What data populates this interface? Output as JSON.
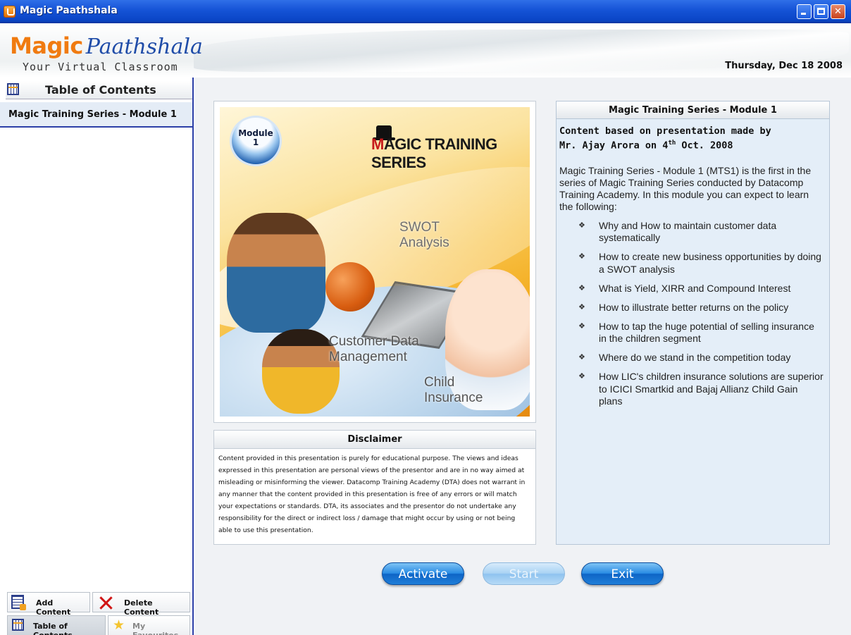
{
  "window": {
    "title": "Magic Paathshala"
  },
  "header": {
    "logo_part1": "Magic",
    "logo_part2": "Paathshala",
    "tagline": "Your Virtual Classroom",
    "date": "Thursday, Dec 18 2008"
  },
  "sidebar": {
    "title": "Table of Contents",
    "items": [
      {
        "label": "Magic Training Series - Module 1"
      }
    ],
    "add_label": "Add Content",
    "delete_label": "Delete Content",
    "toc_tab_label": "Table of Contents",
    "fav_tab_label": "My Favourites"
  },
  "module_image": {
    "badge_line1": "Module",
    "badge_line2": "1",
    "brand_first": "M",
    "brand_rest": "AGIC TRAINING SERIES",
    "label_swot_1": "SWOT",
    "label_swot_2": "Analysis",
    "label_cdm_1": "Customer Data",
    "label_cdm_2": "Management",
    "label_child_1": "Child",
    "label_child_2": "Insurance"
  },
  "disclaimer": {
    "title": "Disclaimer",
    "text": "Content provided in this presentation is purely for educational purpose. The views and ideas expressed in this presentation are personal views of the presentor and are in no way aimed at  misleading or misinforming the viewer. Datacomp Training Academy (DTA) does not warrant in any manner that the content provided in this presentation is free of any errors or will match your expectations or standards. DTA, its associates and the presentor do not undertake any responsibility for the direct or indirect loss / damage that might occur by using or not being able to use this presentation."
  },
  "info": {
    "title": "Magic Training Series - Module 1",
    "subtitle_line1": "Content based on presentation made by",
    "subtitle_line2_a": "Mr. Ajay Arora on 4",
    "subtitle_line2_sup": "th",
    "subtitle_line2_b": " Oct. 2008",
    "description": "Magic Training Series - Module 1 (MTS1)  is the first in the series of Magic Training Series conducted by Datacomp Training Academy. In this module you can expect to learn the following:",
    "bullets": [
      "Why and How to maintain customer data systematically",
      "How to create new business opportunities by doing a SWOT analysis",
      "What is Yield, XIRR and Compound Interest",
      "How to illustrate better returns on the policy",
      "How to tap the huge potential of selling insurance in the children segment",
      "Where do we stand in the competition today",
      "How LIC's children insurance solutions are superior to ICICI Smartkid and Bajaj Allianz Child Gain plans"
    ]
  },
  "actions": {
    "activate_label": "Activate",
    "start_label": "Start",
    "exit_label": "Exit"
  },
  "colors": {
    "titlebar": "#1553d6",
    "logo_orange": "#f07b10",
    "logo_blue": "#1f4ca8",
    "accent_border": "#2b3fa8",
    "button_blue": "#2a8ce4"
  }
}
